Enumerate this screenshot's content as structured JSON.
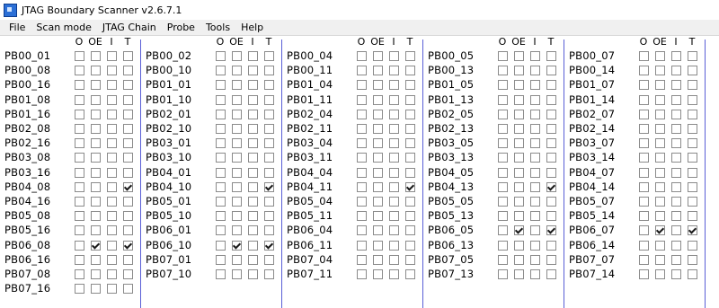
{
  "window": {
    "title": "JTAG Boundary Scanner v2.6.7.1"
  },
  "menu": [
    "File",
    "Scan mode",
    "JTAG Chain",
    "Probe",
    "Tools",
    "Help"
  ],
  "header_labels": [
    "O",
    "OE",
    "I",
    "T"
  ],
  "columns": [
    {
      "pins": [
        {
          "name": "PB00_01",
          "o": false,
          "oe": false,
          "i": false,
          "t": false
        },
        {
          "name": "PB00_08",
          "o": false,
          "oe": false,
          "i": false,
          "t": false
        },
        {
          "name": "PB00_16",
          "o": false,
          "oe": false,
          "i": false,
          "t": false
        },
        {
          "name": "PB01_08",
          "o": false,
          "oe": false,
          "i": false,
          "t": false
        },
        {
          "name": "PB01_16",
          "o": false,
          "oe": false,
          "i": false,
          "t": false
        },
        {
          "name": "PB02_08",
          "o": false,
          "oe": false,
          "i": false,
          "t": false
        },
        {
          "name": "PB02_16",
          "o": false,
          "oe": false,
          "i": false,
          "t": false
        },
        {
          "name": "PB03_08",
          "o": false,
          "oe": false,
          "i": false,
          "t": false
        },
        {
          "name": "PB03_16",
          "o": false,
          "oe": false,
          "i": false,
          "t": false
        },
        {
          "name": "PB04_08",
          "o": false,
          "oe": false,
          "i": false,
          "t": true
        },
        {
          "name": "PB04_16",
          "o": false,
          "oe": false,
          "i": false,
          "t": false
        },
        {
          "name": "PB05_08",
          "o": false,
          "oe": false,
          "i": false,
          "t": false
        },
        {
          "name": "PB05_16",
          "o": false,
          "oe": false,
          "i": false,
          "t": false
        },
        {
          "name": "PB06_08",
          "o": false,
          "oe": true,
          "i": false,
          "t": true
        },
        {
          "name": "PB06_16",
          "o": false,
          "oe": false,
          "i": false,
          "t": false
        },
        {
          "name": "PB07_08",
          "o": false,
          "oe": false,
          "i": false,
          "t": false
        },
        {
          "name": "PB07_16",
          "o": false,
          "oe": false,
          "i": false,
          "t": false
        }
      ]
    },
    {
      "pins": [
        {
          "name": "PB00_02",
          "o": false,
          "oe": false,
          "i": false,
          "t": false
        },
        {
          "name": "PB00_10",
          "o": false,
          "oe": false,
          "i": false,
          "t": false
        },
        {
          "name": "PB01_01",
          "o": false,
          "oe": false,
          "i": false,
          "t": false
        },
        {
          "name": "PB01_10",
          "o": false,
          "oe": false,
          "i": false,
          "t": false
        },
        {
          "name": "PB02_01",
          "o": false,
          "oe": false,
          "i": false,
          "t": false
        },
        {
          "name": "PB02_10",
          "o": false,
          "oe": false,
          "i": false,
          "t": false
        },
        {
          "name": "PB03_01",
          "o": false,
          "oe": false,
          "i": false,
          "t": false
        },
        {
          "name": "PB03_10",
          "o": false,
          "oe": false,
          "i": false,
          "t": false
        },
        {
          "name": "PB04_01",
          "o": false,
          "oe": false,
          "i": false,
          "t": false
        },
        {
          "name": "PB04_10",
          "o": false,
          "oe": false,
          "i": false,
          "t": true
        },
        {
          "name": "PB05_01",
          "o": false,
          "oe": false,
          "i": false,
          "t": false
        },
        {
          "name": "PB05_10",
          "o": false,
          "oe": false,
          "i": false,
          "t": false
        },
        {
          "name": "PB06_01",
          "o": false,
          "oe": false,
          "i": false,
          "t": false
        },
        {
          "name": "PB06_10",
          "o": false,
          "oe": true,
          "i": false,
          "t": true
        },
        {
          "name": "PB07_01",
          "o": false,
          "oe": false,
          "i": false,
          "t": false
        },
        {
          "name": "PB07_10",
          "o": false,
          "oe": false,
          "i": false,
          "t": false
        }
      ]
    },
    {
      "pins": [
        {
          "name": "PB00_04",
          "o": false,
          "oe": false,
          "i": false,
          "t": false
        },
        {
          "name": "PB00_11",
          "o": false,
          "oe": false,
          "i": false,
          "t": false
        },
        {
          "name": "PB01_04",
          "o": false,
          "oe": false,
          "i": false,
          "t": false
        },
        {
          "name": "PB01_11",
          "o": false,
          "oe": false,
          "i": false,
          "t": false
        },
        {
          "name": "PB02_04",
          "o": false,
          "oe": false,
          "i": false,
          "t": false
        },
        {
          "name": "PB02_11",
          "o": false,
          "oe": false,
          "i": false,
          "t": false
        },
        {
          "name": "PB03_04",
          "o": false,
          "oe": false,
          "i": false,
          "t": false
        },
        {
          "name": "PB03_11",
          "o": false,
          "oe": false,
          "i": false,
          "t": false
        },
        {
          "name": "PB04_04",
          "o": false,
          "oe": false,
          "i": false,
          "t": false
        },
        {
          "name": "PB04_11",
          "o": false,
          "oe": false,
          "i": false,
          "t": true
        },
        {
          "name": "PB05_04",
          "o": false,
          "oe": false,
          "i": false,
          "t": false
        },
        {
          "name": "PB05_11",
          "o": false,
          "oe": false,
          "i": false,
          "t": false
        },
        {
          "name": "PB06_04",
          "o": false,
          "oe": false,
          "i": false,
          "t": false
        },
        {
          "name": "PB06_11",
          "o": false,
          "oe": false,
          "i": false,
          "t": false
        },
        {
          "name": "PB07_04",
          "o": false,
          "oe": false,
          "i": false,
          "t": false
        },
        {
          "name": "PB07_11",
          "o": false,
          "oe": false,
          "i": false,
          "t": false
        }
      ]
    },
    {
      "pins": [
        {
          "name": "PB00_05",
          "o": false,
          "oe": false,
          "i": false,
          "t": false
        },
        {
          "name": "PB00_13",
          "o": false,
          "oe": false,
          "i": false,
          "t": false
        },
        {
          "name": "PB01_05",
          "o": false,
          "oe": false,
          "i": false,
          "t": false
        },
        {
          "name": "PB01_13",
          "o": false,
          "oe": false,
          "i": false,
          "t": false
        },
        {
          "name": "PB02_05",
          "o": false,
          "oe": false,
          "i": false,
          "t": false
        },
        {
          "name": "PB02_13",
          "o": false,
          "oe": false,
          "i": false,
          "t": false
        },
        {
          "name": "PB03_05",
          "o": false,
          "oe": false,
          "i": false,
          "t": false
        },
        {
          "name": "PB03_13",
          "o": false,
          "oe": false,
          "i": false,
          "t": false
        },
        {
          "name": "PB04_05",
          "o": false,
          "oe": false,
          "i": false,
          "t": false
        },
        {
          "name": "PB04_13",
          "o": false,
          "oe": false,
          "i": false,
          "t": true
        },
        {
          "name": "PB05_05",
          "o": false,
          "oe": false,
          "i": false,
          "t": false
        },
        {
          "name": "PB05_13",
          "o": false,
          "oe": false,
          "i": false,
          "t": false
        },
        {
          "name": "PB06_05",
          "o": false,
          "oe": true,
          "i": false,
          "t": true
        },
        {
          "name": "PB06_13",
          "o": false,
          "oe": false,
          "i": false,
          "t": false
        },
        {
          "name": "PB07_05",
          "o": false,
          "oe": false,
          "i": false,
          "t": false
        },
        {
          "name": "PB07_13",
          "o": false,
          "oe": false,
          "i": false,
          "t": false
        }
      ]
    },
    {
      "pins": [
        {
          "name": "PB00_07",
          "o": false,
          "oe": false,
          "i": false,
          "t": false
        },
        {
          "name": "PB00_14",
          "o": false,
          "oe": false,
          "i": false,
          "t": false
        },
        {
          "name": "PB01_07",
          "o": false,
          "oe": false,
          "i": false,
          "t": false
        },
        {
          "name": "PB01_14",
          "o": false,
          "oe": false,
          "i": false,
          "t": false
        },
        {
          "name": "PB02_07",
          "o": false,
          "oe": false,
          "i": false,
          "t": false
        },
        {
          "name": "PB02_14",
          "o": false,
          "oe": false,
          "i": false,
          "t": false
        },
        {
          "name": "PB03_07",
          "o": false,
          "oe": false,
          "i": false,
          "t": false
        },
        {
          "name": "PB03_14",
          "o": false,
          "oe": false,
          "i": false,
          "t": false
        },
        {
          "name": "PB04_07",
          "o": false,
          "oe": false,
          "i": false,
          "t": false
        },
        {
          "name": "PB04_14",
          "o": false,
          "oe": false,
          "i": false,
          "t": false
        },
        {
          "name": "PB05_07",
          "o": false,
          "oe": false,
          "i": false,
          "t": false
        },
        {
          "name": "PB05_14",
          "o": false,
          "oe": false,
          "i": false,
          "t": false
        },
        {
          "name": "PB06_07",
          "o": false,
          "oe": true,
          "i": false,
          "t": true
        },
        {
          "name": "PB06_14",
          "o": false,
          "oe": false,
          "i": false,
          "t": false
        },
        {
          "name": "PB07_07",
          "o": false,
          "oe": false,
          "i": false,
          "t": false
        },
        {
          "name": "PB07_14",
          "o": false,
          "oe": false,
          "i": false,
          "t": false
        }
      ]
    }
  ]
}
